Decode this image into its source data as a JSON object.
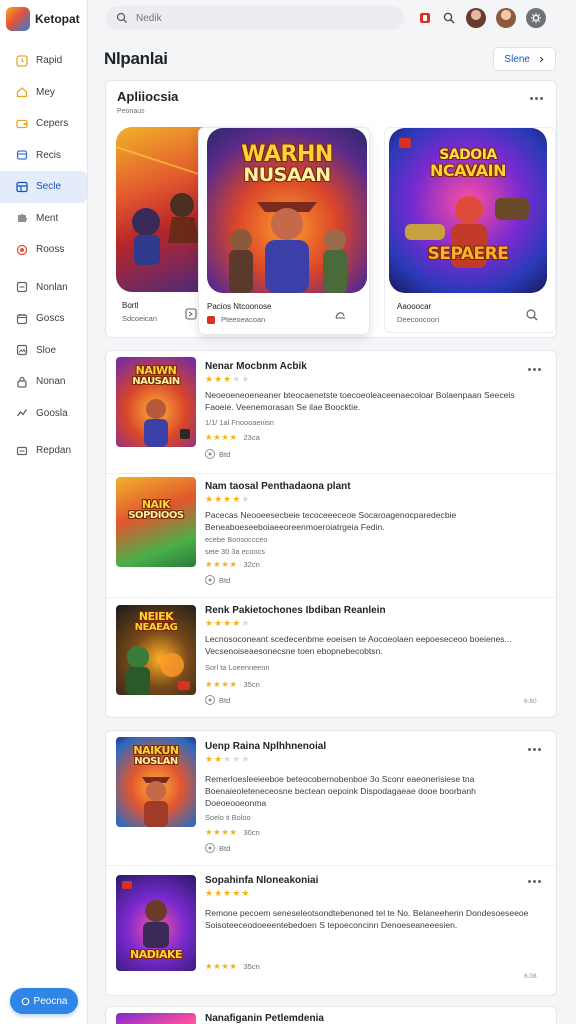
{
  "app": {
    "name": "Ketopat"
  },
  "sidebar": {
    "items": [
      {
        "label": "Rapid",
        "icon": "clock-icon"
      },
      {
        "label": "Mey",
        "icon": "home-icon"
      },
      {
        "label": "Cepers",
        "icon": "wallet-icon"
      },
      {
        "label": "Recis",
        "icon": "box-icon"
      },
      {
        "label": "Secle",
        "icon": "grid-icon",
        "active": true
      },
      {
        "label": "Ment",
        "icon": "puzzle-icon"
      },
      {
        "label": "Rooss",
        "icon": "record-icon"
      },
      {
        "label": "Nonlan",
        "icon": "square-icon"
      },
      {
        "label": "Goscs",
        "icon": "calendar-icon"
      },
      {
        "label": "Sloe",
        "icon": "image-icon"
      },
      {
        "label": "Nonan",
        "icon": "lock-icon"
      },
      {
        "label": "Goosla",
        "icon": "chart-icon"
      },
      {
        "label": "Repdan",
        "icon": "mail-icon"
      }
    ],
    "promo_label": "Peocna"
  },
  "topbar": {
    "search_placeholder": "Nedik"
  },
  "main": {
    "title": "Nlpanlai",
    "head_button": "Slene"
  },
  "featured": {
    "title": "Apliiocsia",
    "subtitle": "Peonaus",
    "cards": [
      {
        "caption": "Bortl",
        "sub": "Sdcoeican"
      },
      {
        "caption": "Pacios Ntcoonose",
        "sub": "Pteeoeacoan",
        "art_line1": "WARHN",
        "art_line2": "NUSAAN"
      },
      {
        "caption": "Aaooocar",
        "sub": "Deecoocoon",
        "art_line1": "SADOIA",
        "art_line2": "NCAVAIN",
        "art_line3": "SEPAERE"
      }
    ]
  },
  "section1": {
    "items": [
      {
        "title": "Nenar Mocbnm Acbik",
        "rating": 3,
        "desc": "Neoeoeneoeneaner bteocaenetste toecoeoleaceenaecoloar Bolaenpaan Seeceis Faoeie. Veenemorasan Se ilae Boocktie.",
        "meta": "1/1/ 1al Fnoooaenisn",
        "rating_text": "23ca",
        "foot": "Btd",
        "art_line1": "NAIWN",
        "art_line2": "NAUSAIN"
      },
      {
        "title": "Nam taosal Penthadaona plant",
        "rating": 4,
        "desc": "Pacecas Neooeesecbeie tecoceeeceoe Socaroagenocparedecbie Beneaboeseeboiaeeoreenmoeroiatrgeia Fedin.",
        "meta_line1": "ecebe Bonsoccceo",
        "meta": "sete 30 3a ecoocs",
        "rating_text": "32cn",
        "foot": "Btd",
        "art_line1": "NAIK",
        "art_line2": "SOPDIOOS"
      },
      {
        "title": "Renk Pakietochones Ibdiban Reanlein",
        "rating": 4,
        "desc": "Lecnosoconeant scedecenbme eoeisen te Aocoeolaen eepoeseceoo boeienes... Vecsenoiseaesonecsne toen ebopnebecobtsn.",
        "meta": "Sorl ta Loeenneenn",
        "rating_text": "35cn",
        "foot": "Btd",
        "corner": "6.60",
        "art_line1": "NEIEK",
        "art_line2": "NEAEAG"
      }
    ]
  },
  "section2": {
    "items": [
      {
        "title": "Uenp Raina Nplhhnenoial",
        "rating": 2,
        "desc": "Remerloesleeieeboe beteocobernobenboe 3o Sconr eaeonerisiese tna Boenaieoleteneceosne bectean oepoink Dispodagaeae dooe boorbanh Doeoeooeonma",
        "meta": "Soelo ti Boloo",
        "rating_text": "30cn",
        "foot": "Btd",
        "art_line1": "NAIKUN",
        "art_line2": "NOSLAN"
      },
      {
        "title": "Sopahinfa Nloneakoniai",
        "rating": 5,
        "desc": "Remone pecoem seneseleotsondtebenoned tel te No. Belaneeherin Dondesoeseeoe Soisoteeceodoeeentebedoen S tepoeconcinn Denoeseaneeesien.",
        "meta": "",
        "rating_text": "35cn",
        "foot": "",
        "corner": "6.08",
        "art_line1": "",
        "art_line2": "NADIAKE"
      }
    ]
  },
  "section3": {
    "items": [
      {
        "title": "Nanafiganin Petlemdenia"
      }
    ]
  },
  "colors": {
    "accent": "#2f86e6",
    "active_bg": "#e3ecf8",
    "star": "#f5b316"
  }
}
